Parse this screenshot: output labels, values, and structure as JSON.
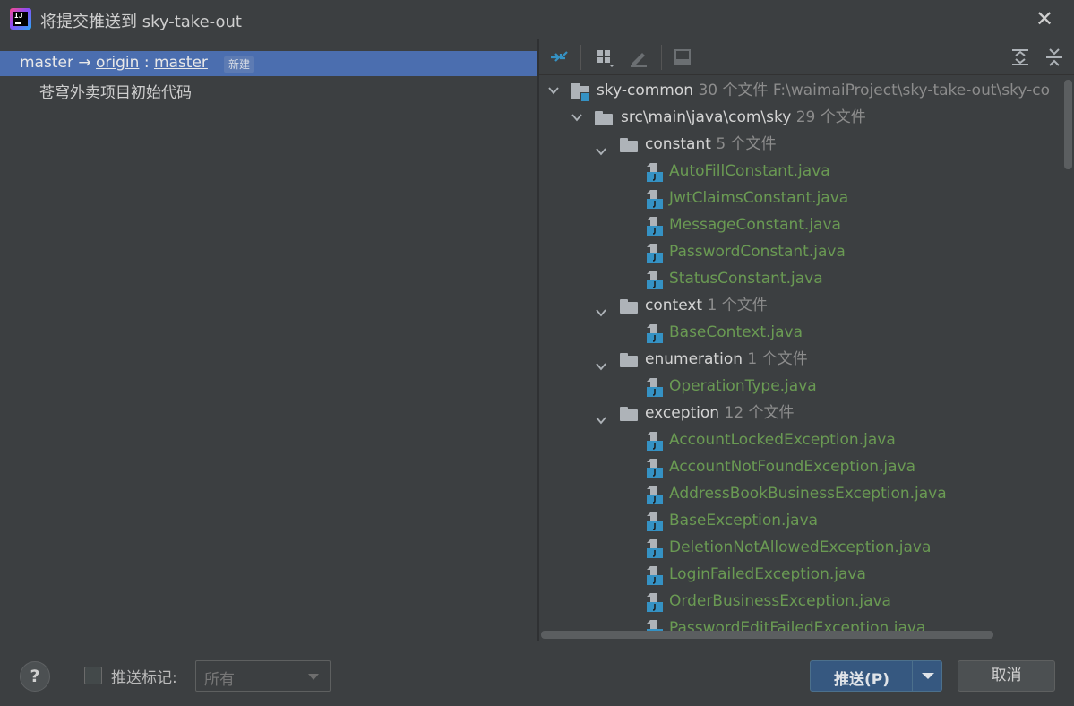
{
  "window": {
    "title": "将提交推送到 sky-take-out",
    "close_glyph": "✕"
  },
  "left": {
    "branch": {
      "local": "master",
      "arrow": "→",
      "remote": "origin",
      "separator": ":",
      "remote_branch": "master",
      "badge": "新建"
    },
    "commits": [
      {
        "message": "苍穹外卖项目初始代码"
      }
    ]
  },
  "toolbar": {
    "icons": [
      "show-diff-icon",
      "group-by-icon",
      "edit-source-icon",
      "preview-icon",
      "expand-all-icon",
      "collapse-all-icon"
    ]
  },
  "tree": {
    "root": {
      "name": "sky-common",
      "count": "30 个文件",
      "path": "F:\\waimaiProject\\sky-take-out\\sky-co"
    },
    "pkg": {
      "name": "src\\main\\java\\com\\sky",
      "count": "29 个文件"
    },
    "folders": [
      {
        "name": "constant",
        "count": "5 个文件",
        "files": [
          "AutoFillConstant.java",
          "JwtClaimsConstant.java",
          "MessageConstant.java",
          "PasswordConstant.java",
          "StatusConstant.java"
        ]
      },
      {
        "name": "context",
        "count": "1 个文件",
        "files": [
          "BaseContext.java"
        ]
      },
      {
        "name": "enumeration",
        "count": "1 个文件",
        "files": [
          "OperationType.java"
        ]
      },
      {
        "name": "exception",
        "count": "12 个文件",
        "files": [
          "AccountLockedException.java",
          "AccountNotFoundException.java",
          "AddressBookBusinessException.java",
          "BaseException.java",
          "DeletionNotAllowedException.java",
          "LoginFailedException.java",
          "OrderBusinessException.java",
          "PasswordEditFailedException.java"
        ]
      }
    ]
  },
  "bottom": {
    "help": "?",
    "push_tags_label": "推送标记:",
    "push_tags_value": "所有",
    "push_button": "推送(P)",
    "cancel_button": "取消"
  },
  "colors": {
    "selection": "#4b6eaf",
    "java_file": "#6a9a53",
    "push_button": "#365880"
  }
}
